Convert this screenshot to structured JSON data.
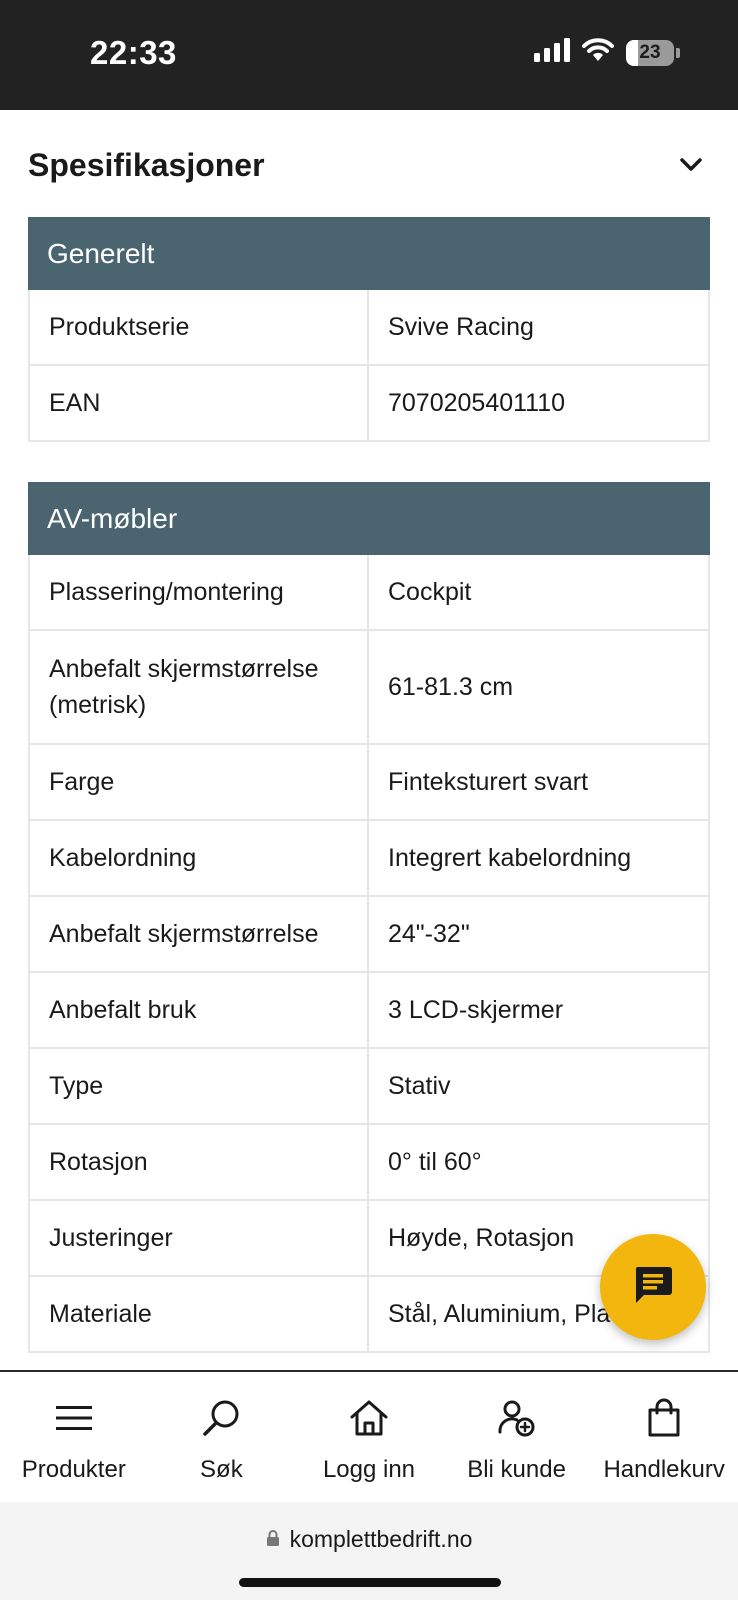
{
  "status_bar": {
    "time": "22:33",
    "battery": "23",
    "icons": [
      "signal-icon",
      "wifi-icon",
      "battery-icon"
    ]
  },
  "section": {
    "title": "Spesifikasjoner",
    "toggle_icon": "chevron-down-icon"
  },
  "tables": [
    {
      "heading": "Generelt",
      "rows": [
        {
          "label": "Produktserie",
          "value": "Svive Racing"
        },
        {
          "label": "EAN",
          "value": "7070205401110"
        }
      ]
    },
    {
      "heading": "AV-møbler",
      "rows": [
        {
          "label": "Plassering/montering",
          "value": "Cockpit"
        },
        {
          "label": "Anbefalt skjermstørrelse (metrisk)",
          "value": "61-81.3 cm"
        },
        {
          "label": "Farge",
          "value": "Finteksturert svart"
        },
        {
          "label": "Kabelordning",
          "value": "Integrert kabelordning"
        },
        {
          "label": "Anbefalt skjermstørrelse",
          "value": "24\"-32\""
        },
        {
          "label": "Anbefalt bruk",
          "value": "3 LCD-skjermer"
        },
        {
          "label": "Type",
          "value": "Stativ"
        },
        {
          "label": "Rotasjon",
          "value": "0° til 60°"
        },
        {
          "label": "Justeringer",
          "value": "Høyde, Rotasjon"
        },
        {
          "label": "Materiale",
          "value": "Stål, Aluminium, Pla"
        }
      ]
    }
  ],
  "chat_button": {
    "icon": "chat-icon"
  },
  "bottom_nav": [
    {
      "label": "Produkter",
      "icon": "menu-icon"
    },
    {
      "label": "Søk",
      "icon": "search-icon"
    },
    {
      "label": "Logg inn",
      "icon": "home-icon"
    },
    {
      "label": "Bli kunde",
      "icon": "add-user-icon"
    },
    {
      "label": "Handlekurv",
      "icon": "shopping-bag-icon"
    }
  ],
  "browser": {
    "url": "komplettbedrift.no",
    "lock_icon": "lock-icon"
  },
  "colors": {
    "table_header": "#4a6470",
    "chat_button": "#f2b60f",
    "status_bar": "#222222"
  }
}
